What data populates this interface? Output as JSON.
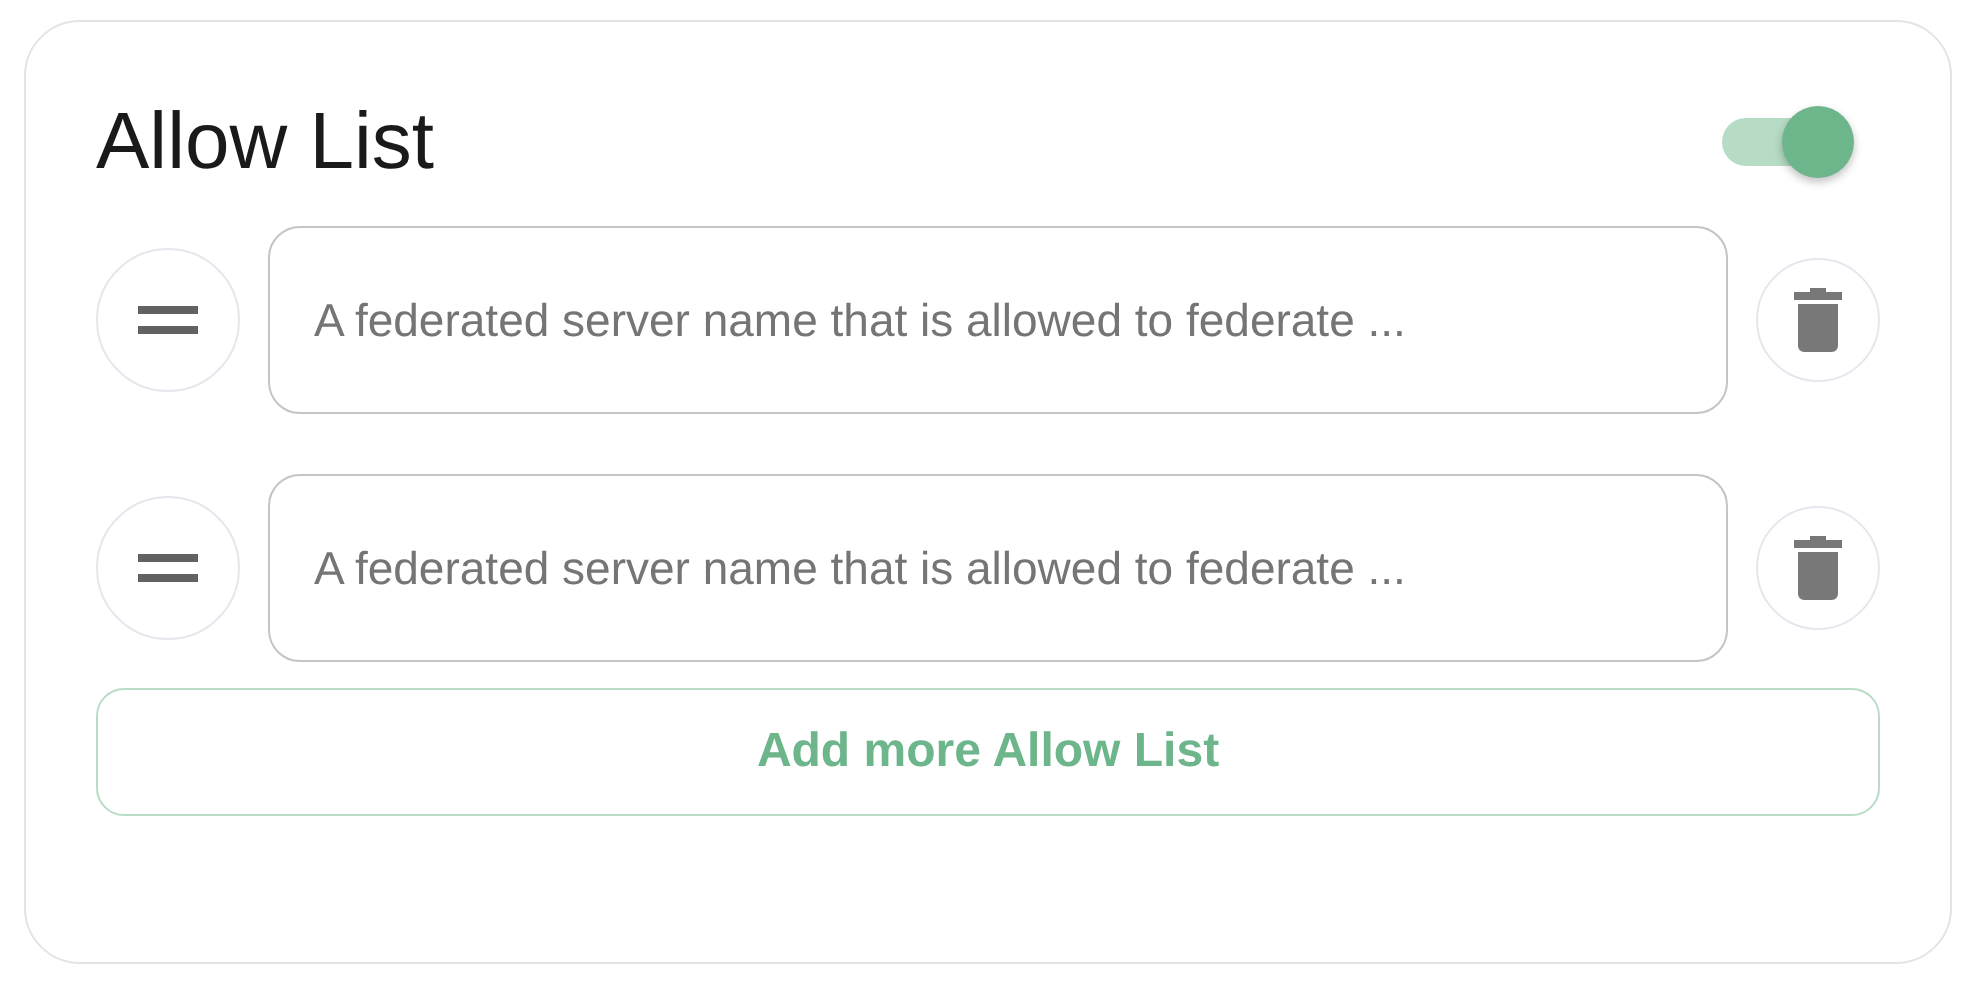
{
  "title": "Allow List",
  "toggle": {
    "on": true
  },
  "entries": [
    {
      "placeholder": "A federated server name that is allowed to federate ..."
    },
    {
      "placeholder": "A federated server name that is allowed to federate ..."
    }
  ],
  "add_button": "Add more Allow List"
}
